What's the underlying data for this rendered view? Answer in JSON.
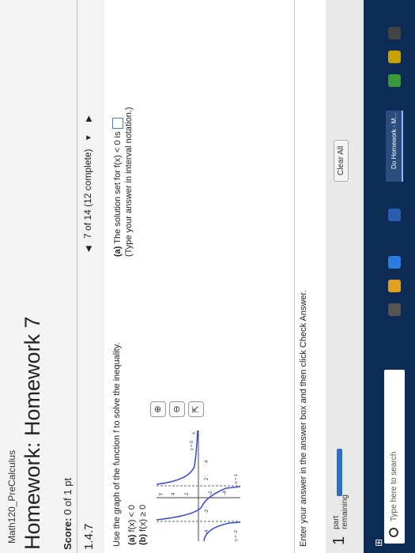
{
  "header": {
    "course": "Math120_PreCalculus",
    "title": "Homework: Homework 7",
    "score_label": "Score:",
    "score_value": "0 of 1 pt"
  },
  "question": {
    "number": "1.4.7",
    "nav_text": "7 of 14 (12 complete)",
    "prompt": "Use the graph of the function f to solve the inequality.",
    "part_a_label": "(a)",
    "part_a": "f(x) < 0",
    "part_b_label": "(b)",
    "part_b": "f(x) ≥ 0",
    "answer_label": "(a)",
    "answer_text": "The solution set for f(x) < 0 is",
    "answer_hint": "(Type your answer in interval notation.)",
    "instruction": "Enter your answer in the answer box and then click Check Answer."
  },
  "graph": {
    "x_ticks": [
      "-4",
      "-2",
      "2",
      "4"
    ],
    "y_ticks": [
      "4",
      "2",
      "-2",
      "-4"
    ],
    "y_label": "y",
    "x_label": "x",
    "asym_label_1": "x = -2",
    "asym_label_2": "x = 1",
    "asym_label_3": "y = 0"
  },
  "footer": {
    "part_number": "1",
    "part_label_1": "part",
    "part_label_2": "remaining",
    "clear_all": "Clear All",
    "progress_fraction": 0.15
  },
  "taskbar": {
    "search_placeholder": "Type here to search",
    "app_label": "Do Homework - M..."
  },
  "colors": {
    "accent": "#2d6fbe",
    "taskbar": "#0c2c56",
    "curve": "#3b4fd1"
  }
}
